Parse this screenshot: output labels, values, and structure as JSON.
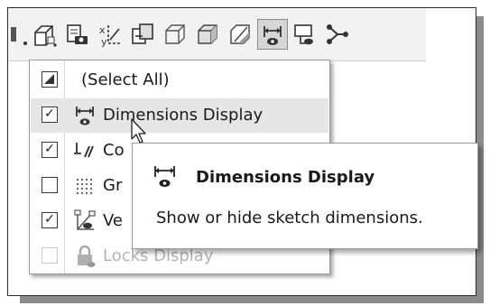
{
  "toolbar": {
    "icons": [
      {
        "name": "toolbar-separator-dot",
        "active": false
      },
      {
        "name": "sketch-view-icon",
        "active": false
      },
      {
        "name": "capture-snapshot-icon",
        "active": false
      },
      {
        "name": "axis-transform-icon",
        "active": false
      },
      {
        "name": "copy-icon",
        "active": false
      },
      {
        "name": "solid-box-icon",
        "active": false
      },
      {
        "name": "shaded-box-icon",
        "active": false
      },
      {
        "name": "section-view-icon",
        "active": false
      },
      {
        "name": "dimensions-display-icon",
        "active": true
      },
      {
        "name": "sketch-hide-icon",
        "active": false
      },
      {
        "name": "connector-icon",
        "active": false
      }
    ]
  },
  "menu": {
    "items": [
      {
        "label": "(Select All)",
        "checked": "partial",
        "icon": "none",
        "disabled": false
      },
      {
        "label": "Dimensions Display",
        "checked": true,
        "icon": "dimensions-display-icon",
        "disabled": false,
        "hover": true
      },
      {
        "label": "Co",
        "checked": true,
        "icon": "constraints-display-icon",
        "disabled": false
      },
      {
        "label": "Gr",
        "checked": false,
        "icon": "grid-display-icon",
        "disabled": false
      },
      {
        "label": "Ve",
        "checked": true,
        "icon": "vertices-display-icon",
        "disabled": false
      },
      {
        "label": "Locks Display",
        "checked": false,
        "icon": "lock-icon",
        "disabled": true
      }
    ]
  },
  "tooltip": {
    "title": "Dimensions Display",
    "description": "Show or hide sketch dimensions.",
    "icon": "dimensions-display-icon"
  },
  "cursor": {
    "icon": "mouse-pointer-icon"
  }
}
